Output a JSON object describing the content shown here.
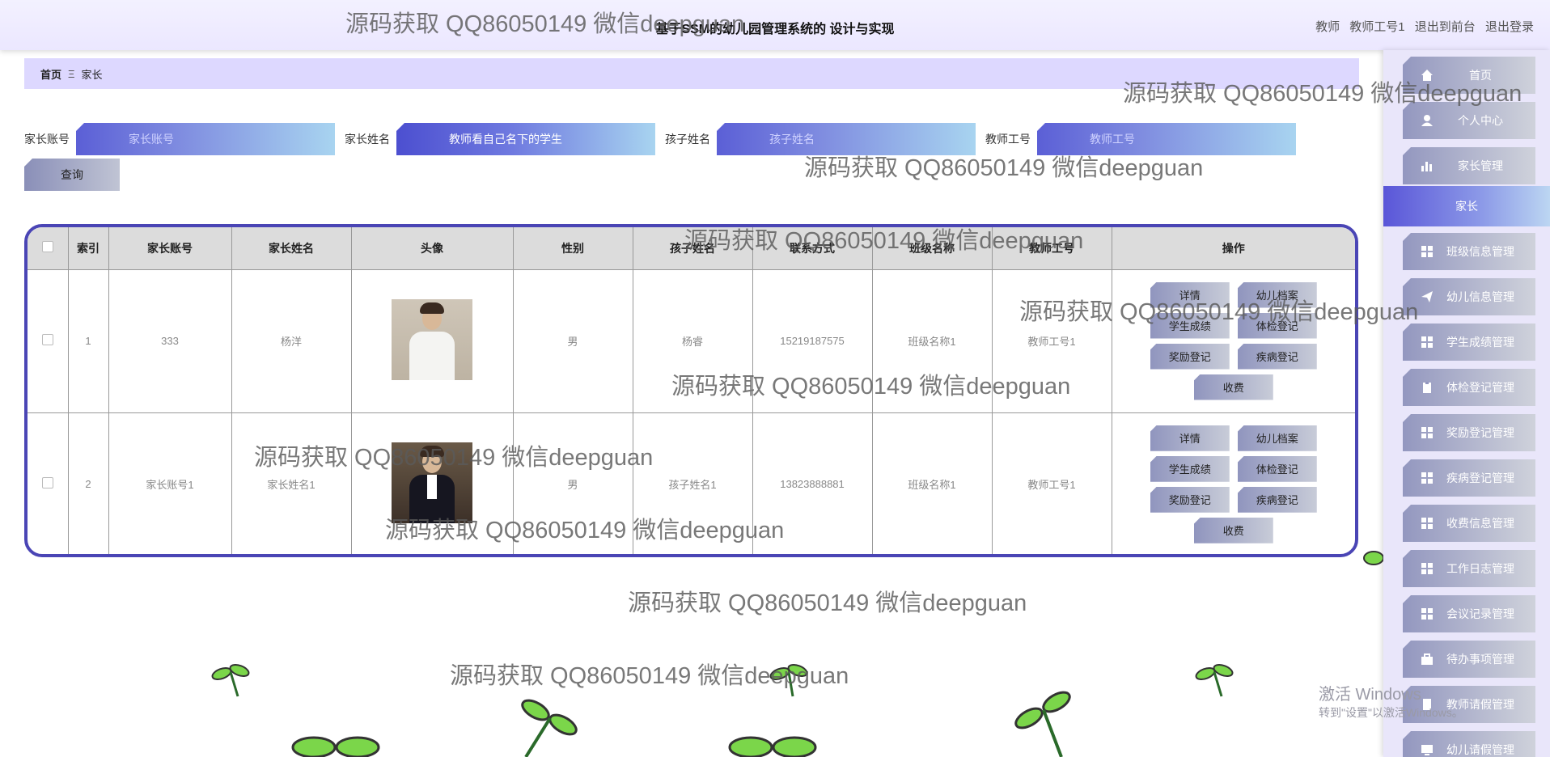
{
  "header": {
    "title": "基于SSM的幼儿园管理系统的 设计与实现",
    "user_role": "教师",
    "user_name": "教师工号1",
    "exit_front": "退出到前台",
    "logout": "退出登录"
  },
  "breadcrumb": {
    "home": "首页",
    "sep": "Ξ",
    "current": "家长"
  },
  "search": {
    "f1_label": "家长账号",
    "f1_placeholder": "家长账号",
    "f2_label": "家长姓名",
    "f2_value": "教师看自己名下的学生",
    "f3_label": "孩子姓名",
    "f3_placeholder": "孩子姓名",
    "f4_label": "教师工号",
    "f4_placeholder": "教师工号",
    "query": "查询"
  },
  "table": {
    "headers": [
      "索引",
      "家长账号",
      "家长姓名",
      "头像",
      "性别",
      "孩子姓名",
      "联系方式",
      "班级名称",
      "教师工号",
      "操作"
    ],
    "rows": [
      {
        "index": "1",
        "account": "333",
        "name": "杨洋",
        "gender": "男",
        "child": "杨睿",
        "phone": "15219187575",
        "class": "班级名称1",
        "teacher": "教师工号1"
      },
      {
        "index": "2",
        "account": "家长账号1",
        "name": "家长姓名1",
        "gender": "男",
        "child": "孩子姓名1",
        "phone": "13823888881",
        "class": "班级名称1",
        "teacher": "教师工号1"
      }
    ],
    "ops": {
      "detail": "详情",
      "archive": "幼儿档案",
      "score": "学生成绩",
      "physical": "体检登记",
      "reward": "奖励登记",
      "illness": "疾病登记",
      "fee": "收费"
    }
  },
  "sidebar": {
    "items": [
      "首页",
      "个人中心",
      "家长管理"
    ],
    "active": "家长",
    "items2": [
      "班级信息管理",
      "幼儿信息管理",
      "学生成绩管理",
      "体检登记管理",
      "奖励登记管理",
      "疾病登记管理",
      "收费信息管理",
      "工作日志管理",
      "会议记录管理",
      "待办事项管理",
      "教师请假管理",
      "幼儿请假管理"
    ]
  },
  "watermark": "源码获取 QQ86050149 微信deepguan",
  "windows": {
    "line1": "激活 Windows",
    "line2": "转到\"设置\"以激活Windows。"
  },
  "colors": {
    "accent": "#4a45b5",
    "header_bg": "#efecff",
    "breadcrumb_bg": "#ddd8ff",
    "sidebar_bg": "#e9e6fa",
    "prop_green": "#7bd64a"
  }
}
